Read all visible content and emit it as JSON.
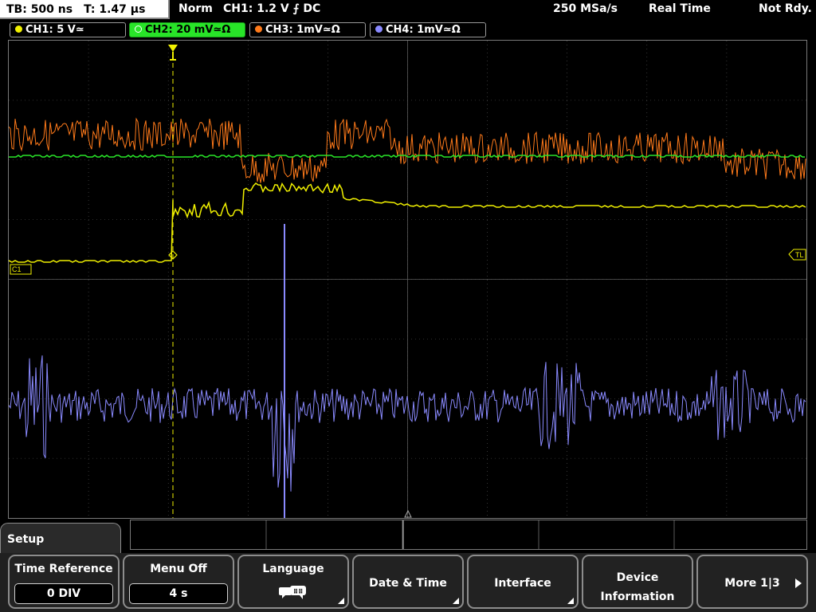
{
  "topbar": {
    "timebase": "TB: 500 ns",
    "trigger_time": "T: 1.47 µs",
    "trigger_mode": "Norm",
    "trigger_info": "CH1: 1.2 V ⨍ DC",
    "sample_rate": "250 MSa/s",
    "acq_mode": "Real Time",
    "status": "Not Rdy."
  },
  "channels": [
    {
      "label": "CH1: 5 V≃",
      "color": "#f0f000"
    },
    {
      "label": "CH2: 20 mV≃Ω",
      "color": "#28e428"
    },
    {
      "label": "CH3: 1mV≃Ω",
      "color": "#ff7a1a"
    },
    {
      "label": "CH4: 1mV≃Ω",
      "color": "#8a8aff"
    }
  ],
  "screen": {
    "ch1_marker": "C1",
    "trigger_level_marker": "TL"
  },
  "colors": {
    "ch1": "#f0f000",
    "ch2": "#28e428",
    "ch3": "#ff7a1a",
    "ch4": "#8a8aff",
    "grid": "#5a5a5a",
    "trigger": "#f0f000"
  },
  "menu": {
    "title": "Setup",
    "softkeys": {
      "time_reference": {
        "title": "Time Reference",
        "value": "0 DIV"
      },
      "menu_off": {
        "title": "Menu Off",
        "value": "4 s"
      },
      "language": {
        "title": "Language",
        "icon": "speech-bubbles-icon"
      },
      "date_time": {
        "title": "Date & Time"
      },
      "interface": {
        "title": "Interface"
      },
      "device_info": {
        "line1": "Device",
        "line2": "Information"
      },
      "more": {
        "title": "More 1|3"
      }
    }
  }
}
